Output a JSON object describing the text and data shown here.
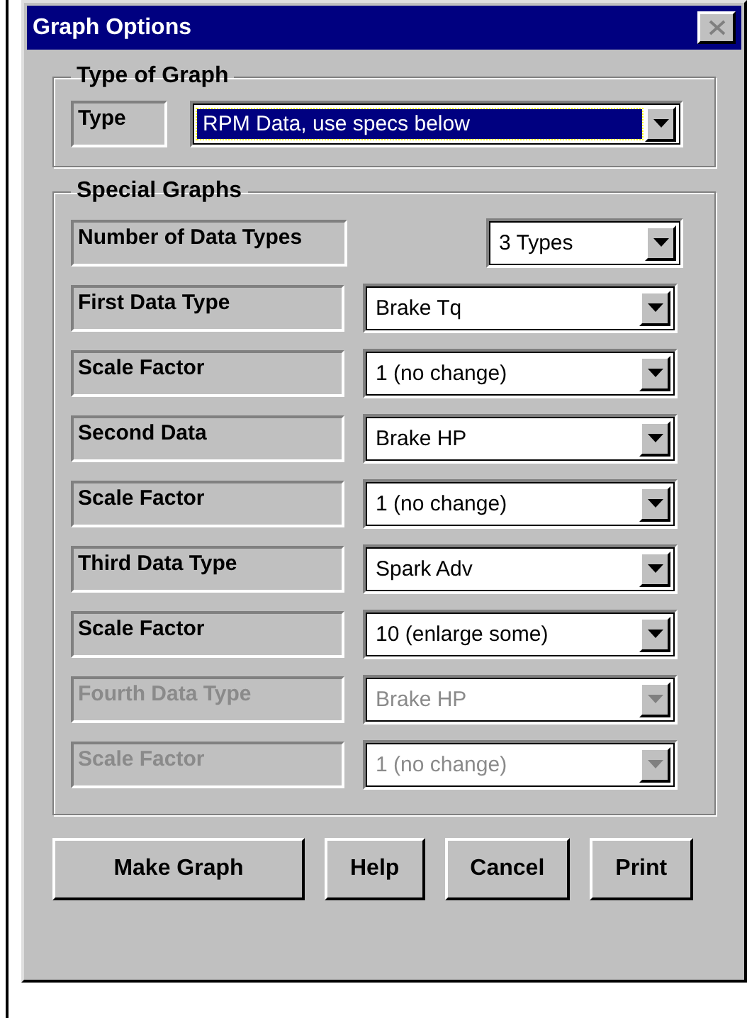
{
  "window": {
    "title": "Graph Options"
  },
  "type_group": {
    "title": "Type of Graph",
    "label": "Type",
    "value": "RPM Data, use specs below",
    "highlighted": true
  },
  "special_group": {
    "title": "Special Graphs",
    "count_row": {
      "label": "Number of Data Types",
      "value": "3 Types",
      "disabled": false
    },
    "rows": [
      {
        "label": "First Data Type",
        "value": "Brake Tq",
        "disabled": false
      },
      {
        "label": "Scale Factor",
        "value": "1 (no change)",
        "disabled": false
      },
      {
        "label": "Second Data",
        "value": "Brake HP",
        "disabled": false
      },
      {
        "label": "Scale Factor",
        "value": "1 (no change)",
        "disabled": false
      },
      {
        "label": "Third Data Type",
        "value": "Spark Adv",
        "disabled": false
      },
      {
        "label": "Scale Factor",
        "value": "10 (enlarge some)",
        "disabled": false
      },
      {
        "label": "Fourth Data Type",
        "value": "Brake HP",
        "disabled": true
      },
      {
        "label": "Scale Factor",
        "value": "1 (no change)",
        "disabled": true
      }
    ]
  },
  "buttons": [
    "Make Graph",
    "Help",
    "Cancel",
    "Print"
  ]
}
